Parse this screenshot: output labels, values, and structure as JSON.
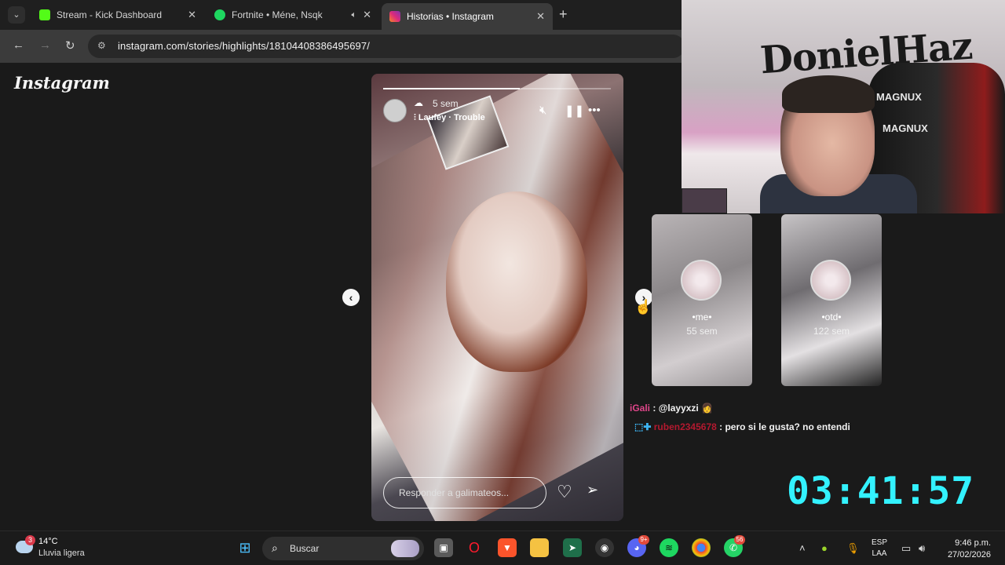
{
  "browser": {
    "tabs": [
      {
        "title": "Stream - Kick Dashboard",
        "favicon_color": "#53fc18"
      },
      {
        "title": "Fortnite • Méne, Nsqk",
        "favicon_color": "#1ed760"
      },
      {
        "title": "Historias • Instagram",
        "favicon_color": "#e1306c"
      }
    ],
    "new_tab_symbol": "+",
    "url": "instagram.com/stories/highlights/18104408386495697/"
  },
  "instagram": {
    "logo": "Instagram",
    "story": {
      "time_ago": "5 sem",
      "music": "Laufey · Trouble",
      "reply_placeholder": "Responder a galimateos...",
      "progress": 0.6
    },
    "highlights": [
      {
        "name": "•me•",
        "age": "55 sem"
      },
      {
        "name": "•otd•",
        "age": "122 sem"
      }
    ]
  },
  "chat": {
    "msg1": {
      "user": "iGali",
      "sep": " : ",
      "text": "@layyxzi"
    },
    "msg2": {
      "user": "ruben2345678",
      "sep": " : ",
      "text": "pero si le gusta? no entendi"
    }
  },
  "webcam": {
    "graffiti": "DonielHaz",
    "chair_brand": "MAGNUX"
  },
  "timer": "03:41:57",
  "taskbar": {
    "weather_badge": "3",
    "temperature": "14°C",
    "condition": "Lluvia ligera",
    "search_label": "Buscar",
    "discord_badge": "9+",
    "whatsapp_badge": "56",
    "lang_top": "ESP",
    "lang_bottom": "LAA",
    "time": "9:46 p.m.",
    "date": "27/02/2026"
  }
}
